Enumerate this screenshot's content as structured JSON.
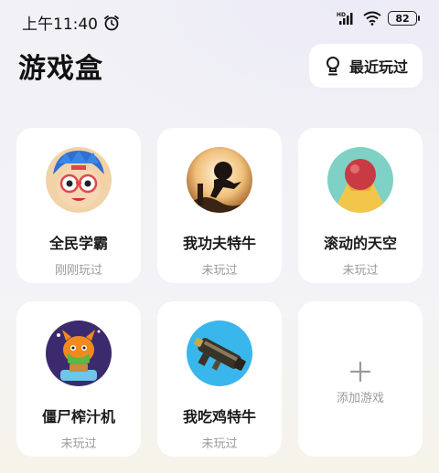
{
  "status_bar": {
    "time": "上午11:40",
    "alarm_icon": "alarm-icon",
    "signal_label": "HD",
    "battery": "82"
  },
  "header": {
    "title": "游戏盒",
    "recent_label": "最近玩过"
  },
  "games": [
    {
      "name": "全民学霸",
      "status": "刚刚玩过"
    },
    {
      "name": "我功夫特牛",
      "status": "未玩过"
    },
    {
      "name": "滚动的天空",
      "status": "未玩过"
    },
    {
      "name": "僵尸榨汁机",
      "status": "未玩过"
    },
    {
      "name": "我吃鸡特牛",
      "status": "未玩过"
    }
  ],
  "add_card": {
    "label": "添加游戏",
    "icon": "plus-icon"
  }
}
